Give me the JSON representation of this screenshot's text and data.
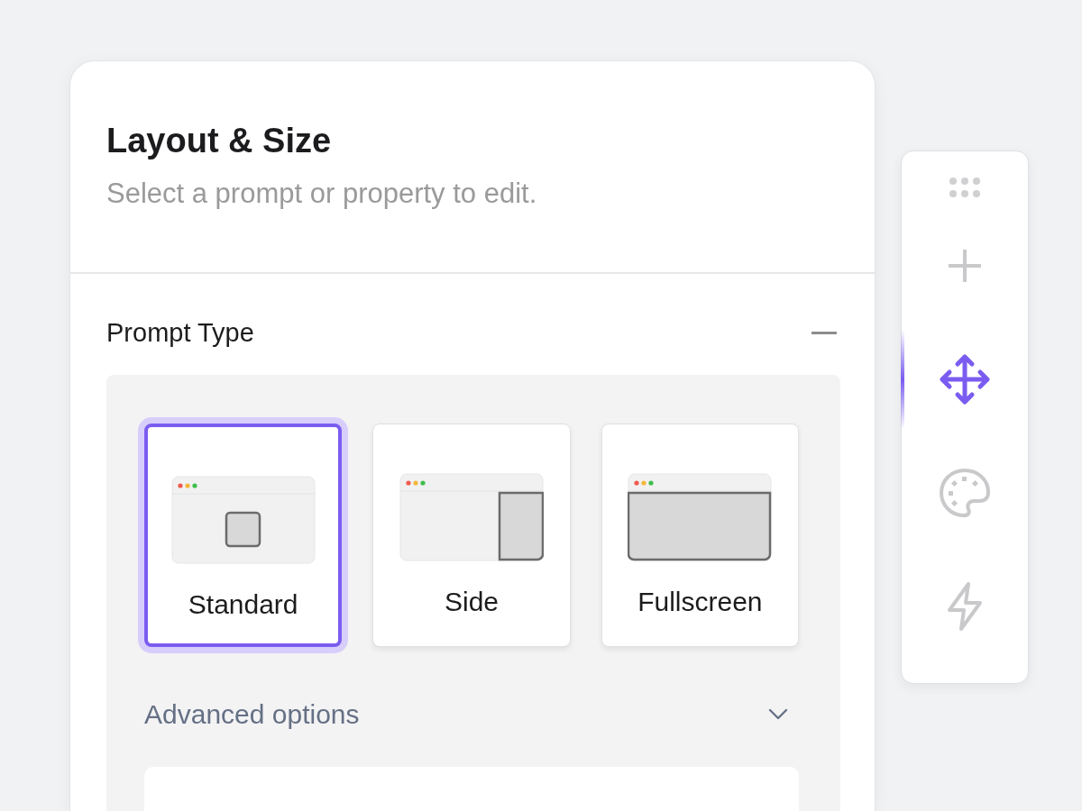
{
  "panel": {
    "title": "Layout & Size",
    "subtitle": "Select a prompt or property to edit."
  },
  "section": {
    "title": "Prompt Type",
    "expanded": true
  },
  "prompt_types": [
    {
      "label": "Standard",
      "kind": "standard",
      "selected": true
    },
    {
      "label": "Side",
      "kind": "side",
      "selected": false
    },
    {
      "label": "Fullscreen",
      "kind": "fullscreen",
      "selected": false
    }
  ],
  "advanced": {
    "label": "Advanced options",
    "expanded": false
  },
  "toolbar": [
    {
      "kind": "add",
      "selected": false
    },
    {
      "kind": "move",
      "selected": true
    },
    {
      "kind": "palette",
      "selected": false
    },
    {
      "kind": "bolt",
      "selected": false
    }
  ]
}
